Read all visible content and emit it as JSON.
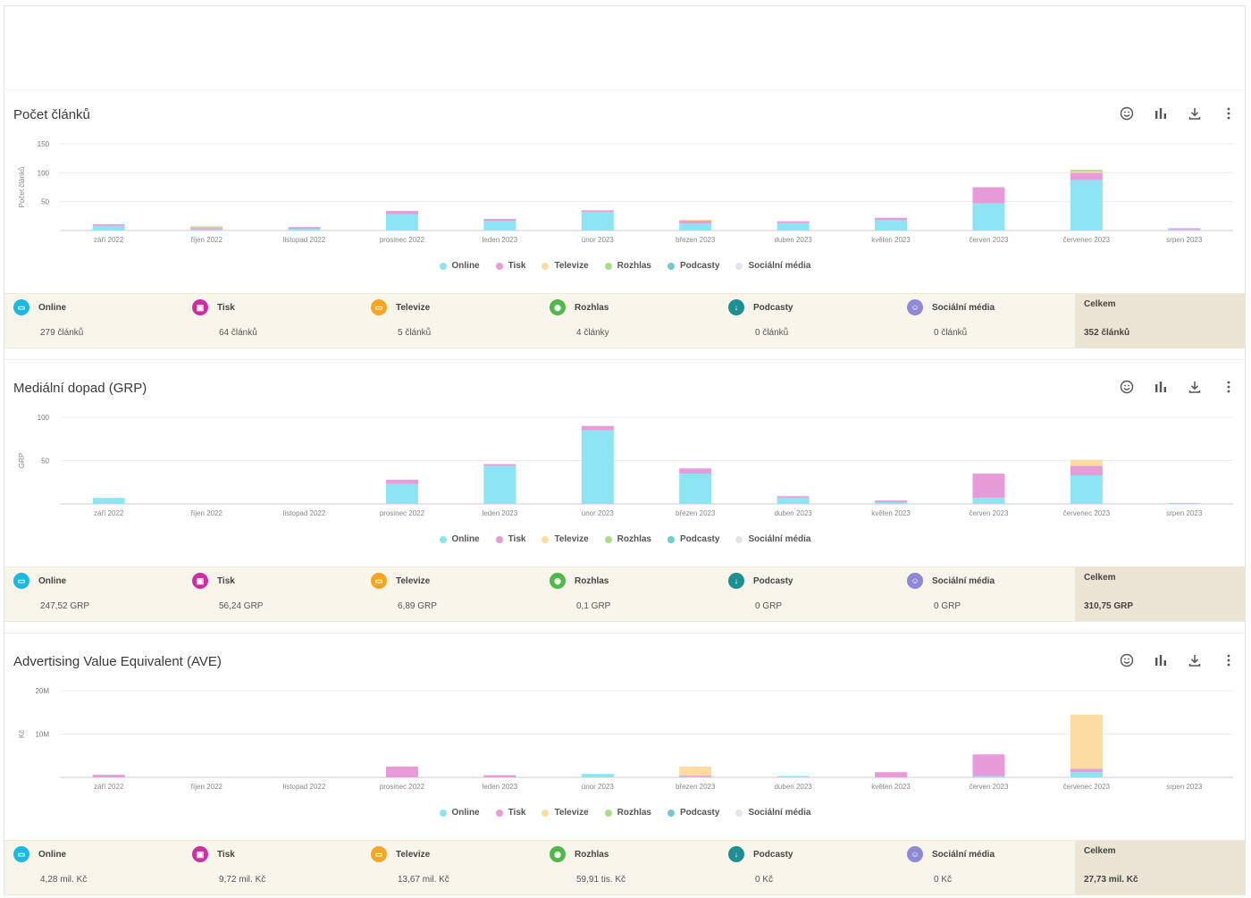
{
  "months": [
    "září 2022",
    "říjen 2022",
    "listopad 2022",
    "prosinec 2022",
    "leden 2023",
    "únor 2023",
    "březen 2023",
    "duben 2023",
    "květen 2023",
    "červen 2023",
    "červenec 2023",
    "srpen 2023"
  ],
  "colors": {
    "Online": "#8de4f2",
    "Tisk": "#e79cd9",
    "Televize": "#fddca1",
    "Rozhlas": "#a9dd8a",
    "Podcasty": "#74c9d2",
    "Sociální média": "#e4e4ee"
  },
  "legend": [
    "Online",
    "Tisk",
    "Televize",
    "Rozhlas",
    "Podcasty",
    "Sociální média"
  ],
  "legend_dot_colors": [
    "#8de4f2",
    "#e79cd9",
    "#fddca1",
    "#a9dd8a",
    "#74c9d2",
    "#e4e4ee"
  ],
  "summary_icon_colors": [
    "#1fb6e0",
    "#cc2fa0",
    "#f6a526",
    "#52b74c",
    "#1e8f92",
    "#8e88d6"
  ],
  "icons": [
    "smiley-icon",
    "bar-chart-icon",
    "download-icon",
    "more-vertical-icon"
  ],
  "chart_data": [
    {
      "type": "bar",
      "title": "Počet článků",
      "ylabel": "Počet článků",
      "yticks": [
        "150",
        "100",
        "50"
      ],
      "ylim": [
        0,
        150
      ],
      "categories": [
        "září 2022",
        "říjen 2022",
        "listopad 2022",
        "prosinec 2022",
        "leden 2023",
        "únor 2023",
        "březen 2023",
        "duben 2023",
        "květen 2023",
        "červen 2023",
        "červenec 2023",
        "srpen 2023"
      ],
      "stacked": true,
      "series": [
        {
          "name": "Online",
          "values": [
            8,
            2,
            3,
            28,
            17,
            32,
            12,
            13,
            18,
            47,
            87,
            3
          ]
        },
        {
          "name": "Tisk",
          "values": [
            3,
            3,
            3,
            6,
            3,
            3,
            5,
            3,
            4,
            28,
            13,
            1
          ]
        },
        {
          "name": "Televize",
          "values": [
            0,
            1,
            0,
            0,
            0,
            0,
            2,
            0,
            0,
            0,
            2,
            0
          ]
        },
        {
          "name": "Rozhlas",
          "values": [
            0,
            1,
            0,
            0,
            0,
            0,
            0,
            0,
            0,
            0,
            3,
            0
          ]
        },
        {
          "name": "Podcasty",
          "values": [
            0,
            0,
            0,
            0,
            0,
            0,
            0,
            0,
            0,
            0,
            0,
            0
          ]
        },
        {
          "name": "Sociální média",
          "values": [
            0,
            0,
            0,
            0,
            0,
            0,
            0,
            0,
            0,
            0,
            0,
            0
          ]
        }
      ]
    },
    {
      "type": "bar",
      "title": "Mediální dopad (GRP)",
      "ylabel": "GRP",
      "yticks": [
        "100",
        "50"
      ],
      "ylim": [
        0,
        100
      ],
      "categories": [
        "září 2022",
        "říjen 2022",
        "listopad 2022",
        "prosinec 2022",
        "leden 2023",
        "únor 2023",
        "březen 2023",
        "duben 2023",
        "květen 2023",
        "červen 2023",
        "červenec 2023",
        "srpen 2023"
      ],
      "stacked": true,
      "series": [
        {
          "name": "Online",
          "values": [
            7,
            0,
            0,
            23,
            44,
            85,
            35,
            7,
            2,
            7,
            33,
            1
          ]
        },
        {
          "name": "Tisk",
          "values": [
            0,
            0,
            0,
            5,
            2,
            5,
            6,
            2,
            2,
            28,
            11,
            0
          ]
        },
        {
          "name": "Televize",
          "values": [
            0,
            0,
            0,
            0,
            0,
            0,
            0,
            0,
            0,
            0,
            7,
            0
          ]
        },
        {
          "name": "Rozhlas",
          "values": [
            0,
            0,
            0,
            0,
            0,
            0,
            0,
            0,
            0,
            0,
            0,
            0
          ]
        },
        {
          "name": "Podcasty",
          "values": [
            0,
            0,
            0,
            0,
            0,
            0,
            0,
            0,
            0,
            0,
            0,
            0
          ]
        },
        {
          "name": "Sociální média",
          "values": [
            0,
            0,
            0,
            0,
            0,
            0,
            0,
            0,
            0,
            0,
            0,
            0
          ]
        }
      ]
    },
    {
      "type": "bar",
      "title": "Advertising Value Equivalent (AVE)",
      "ylabel": "Kč",
      "yticks": [
        "20M",
        "10M"
      ],
      "ylim": [
        0,
        20000000
      ],
      "categories": [
        "září 2022",
        "říjen 2022",
        "listopad 2022",
        "prosinec 2022",
        "leden 2023",
        "únor 2023",
        "březen 2023",
        "duben 2023",
        "květen 2023",
        "červen 2023",
        "červenec 2023",
        "srpen 2023"
      ],
      "stacked": true,
      "series": [
        {
          "name": "Online",
          "values": [
            0,
            0,
            0,
            0,
            0,
            800000,
            200000,
            300000,
            0,
            300000,
            1200000,
            0
          ]
        },
        {
          "name": "Tisk",
          "values": [
            600000,
            0,
            0,
            2500000,
            500000,
            0,
            200000,
            0,
            1200000,
            5000000,
            800000,
            0
          ]
        },
        {
          "name": "Televize",
          "values": [
            0,
            0,
            0,
            0,
            0,
            0,
            2100000,
            0,
            0,
            0,
            12500000,
            0
          ]
        },
        {
          "name": "Rozhlas",
          "values": [
            0,
            0,
            0,
            0,
            0,
            0,
            0,
            0,
            0,
            0,
            0,
            0
          ]
        },
        {
          "name": "Podcasty",
          "values": [
            0,
            0,
            0,
            0,
            0,
            0,
            0,
            0,
            0,
            0,
            0,
            0
          ]
        },
        {
          "name": "Sociální média",
          "values": [
            0,
            0,
            0,
            0,
            0,
            0,
            0,
            0,
            0,
            0,
            0,
            0
          ]
        }
      ]
    }
  ],
  "summaries": [
    {
      "columns": [
        {
          "label": "Online",
          "value": "279 článků"
        },
        {
          "label": "Tisk",
          "value": "64 článků"
        },
        {
          "label": "Televize",
          "value": "5 článků"
        },
        {
          "label": "Rozhlas",
          "value": "4 články"
        },
        {
          "label": "Podcasty",
          "value": "0 článků"
        },
        {
          "label": "Sociální média",
          "value": "0 článků"
        }
      ],
      "total": {
        "label": "Celkem",
        "value": "352 článků"
      }
    },
    {
      "columns": [
        {
          "label": "Online",
          "value": "247,52 GRP"
        },
        {
          "label": "Tisk",
          "value": "56,24 GRP"
        },
        {
          "label": "Televize",
          "value": "6,89 GRP"
        },
        {
          "label": "Rozhlas",
          "value": "0,1 GRP"
        },
        {
          "label": "Podcasty",
          "value": "0 GRP"
        },
        {
          "label": "Sociální média",
          "value": "0 GRP"
        }
      ],
      "total": {
        "label": "Celkem",
        "value": "310,75 GRP"
      }
    },
    {
      "columns": [
        {
          "label": "Online",
          "value": "4,28 mil. Kč"
        },
        {
          "label": "Tisk",
          "value": "9,72 mil. Kč"
        },
        {
          "label": "Televize",
          "value": "13,67 mil. Kč"
        },
        {
          "label": "Rozhlas",
          "value": "59,91 tis. Kč"
        },
        {
          "label": "Podcasty",
          "value": "0 Kč"
        },
        {
          "label": "Sociální média",
          "value": "0 Kč"
        }
      ],
      "total": {
        "label": "Celkem",
        "value": "27,73 mil. Kč"
      }
    }
  ]
}
